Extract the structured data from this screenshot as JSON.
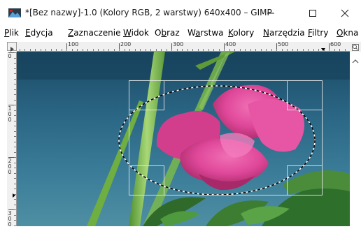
{
  "window": {
    "title": "*[Bez nazwy]-1.0 (Kolory RGB, 2 warstwy) 640x400 – GIMP",
    "minimize_glyph": "—",
    "maximize_glyph": "☐",
    "close_glyph": "✕"
  },
  "menu": [
    {
      "u": "P",
      "rest": "lik"
    },
    {
      "u": "E",
      "rest": "dycja"
    },
    {
      "u": "Z",
      "rest": "aznaczenie"
    },
    {
      "u": "W",
      "rest": "idok"
    },
    {
      "u": "O",
      "rest": "b",
      "rest2": "raz"
    },
    {
      "u": "W",
      "rest": "a",
      "rest2": "rstwa",
      "underline_second": true
    },
    {
      "u": "K",
      "rest": "olory"
    },
    {
      "u": "N",
      "rest": "arzędzia"
    },
    {
      "u": "F",
      "rest": "iltry"
    },
    {
      "u": "O",
      "rest": "kna"
    }
  ],
  "ruler_top": [
    "100",
    "200",
    "300",
    "400",
    "500",
    "600"
  ],
  "ruler_left": [
    {
      "digits": [
        "0"
      ]
    },
    {
      "digits": [
        "1",
        "0",
        "0"
      ]
    },
    {
      "digits": [
        "2",
        "0",
        "0"
      ]
    },
    {
      "digits": [
        "3",
        "0",
        "0"
      ]
    }
  ],
  "colors": {
    "sky_top": "#1b4a63",
    "sky_mid": "#2f6e8c",
    "petal": "#e0489a",
    "petal_dark": "#b8306f",
    "stem": "#79b84a",
    "leaf": "#2f6a2a"
  },
  "icons": {
    "app": "gimp-image-icon",
    "ruler_menu": "ruler-menu-arrow-icon",
    "zoom": "zoom-icon"
  }
}
